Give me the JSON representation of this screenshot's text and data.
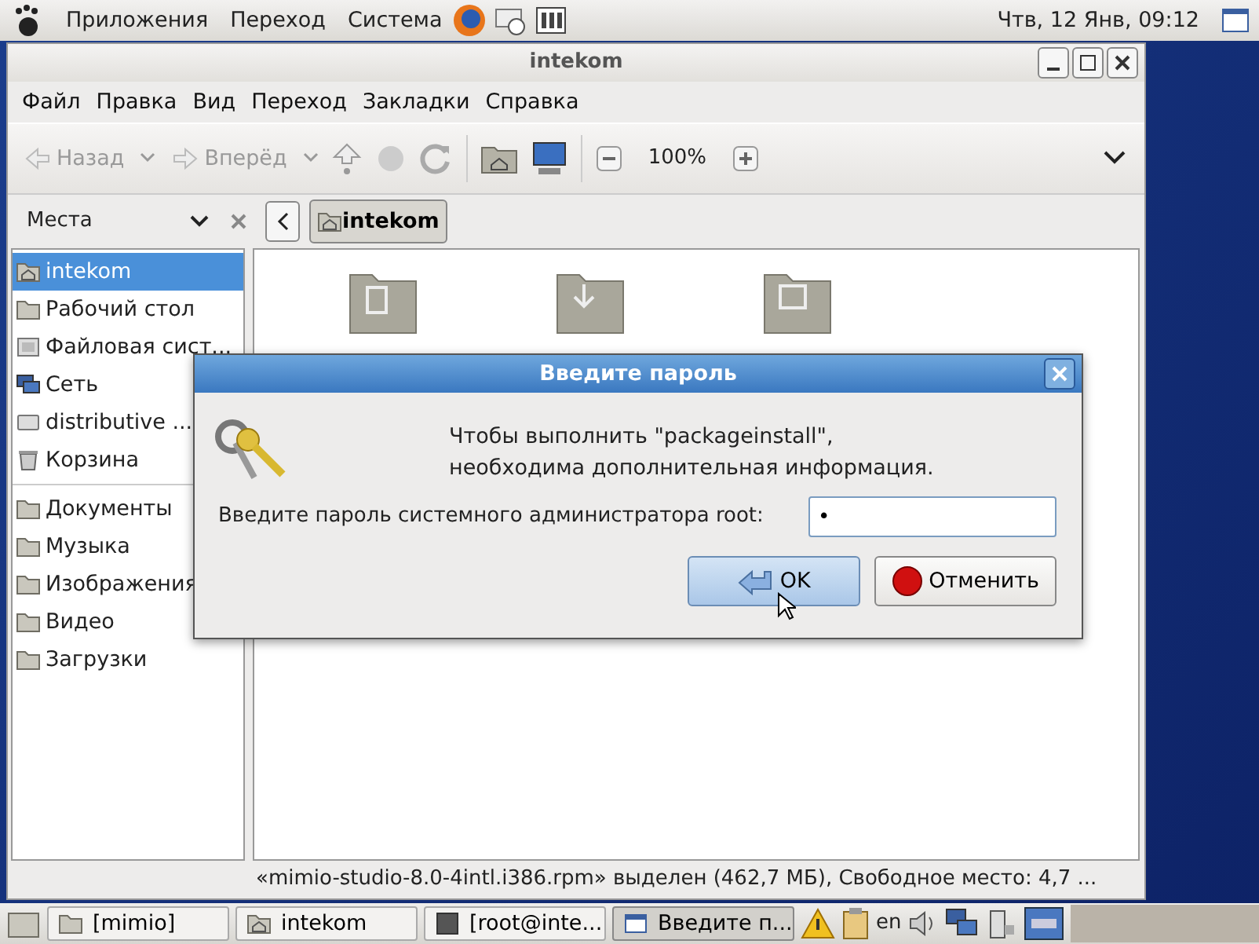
{
  "top_panel": {
    "menus": [
      "Приложения",
      "Переход",
      "Система"
    ],
    "clock": "Чтв, 12 Янв, 09:12"
  },
  "window": {
    "title": "intekom",
    "menu": [
      "Файл",
      "Правка",
      "Вид",
      "Переход",
      "Закладки",
      "Справка"
    ],
    "toolbar": {
      "back": {
        "label": "Назад",
        "disabled": true
      },
      "forward": {
        "label": "Вперёд",
        "disabled": true
      },
      "zoom": "100%"
    },
    "sidebar": {
      "title": "Места",
      "places": [
        {
          "label": "intekom",
          "kind": "home",
          "selected": true
        },
        {
          "label": "Рабочий стол",
          "kind": "folder",
          "selected": false
        },
        {
          "label": "Файловая сист...",
          "kind": "drive",
          "selected": false
        },
        {
          "label": "Сеть",
          "kind": "network",
          "selected": false
        },
        {
          "label": "distributive ...",
          "kind": "disk",
          "selected": false
        },
        {
          "label": "Корзина",
          "kind": "trash",
          "selected": false
        }
      ],
      "bookmarks": [
        {
          "label": "Документы",
          "selected": false
        },
        {
          "label": "Музыка",
          "selected": false
        },
        {
          "label": "Изображения",
          "selected": false
        },
        {
          "label": "Видео",
          "selected": false
        },
        {
          "label": "Загрузки",
          "selected": false
        }
      ]
    },
    "path": {
      "crumb": "intekom"
    },
    "status_bar": "«mimio-studio-8.0-4intl.i386.rpm» выделен (462,7 МБ), Свободное место: 4,7 ..."
  },
  "dialog": {
    "title": "Введите пароль",
    "message_lines": [
      "Чтобы выполнить \"packageinstall\",",
      "необходима дополнительная информация."
    ],
    "field_label": "Введите пароль системного администратора root:",
    "password": "•",
    "buttons": [
      {
        "label": "OK",
        "default": true
      },
      {
        "label": "Отменить",
        "default": false
      }
    ]
  },
  "taskbar": {
    "tasks": [
      {
        "label": "[mimio]",
        "selected": false
      },
      {
        "label": "intekom",
        "selected": false
      },
      {
        "label": "[root@inte...",
        "selected": false
      },
      {
        "label": "Введите п...",
        "selected": true
      }
    ],
    "layout": "en"
  }
}
